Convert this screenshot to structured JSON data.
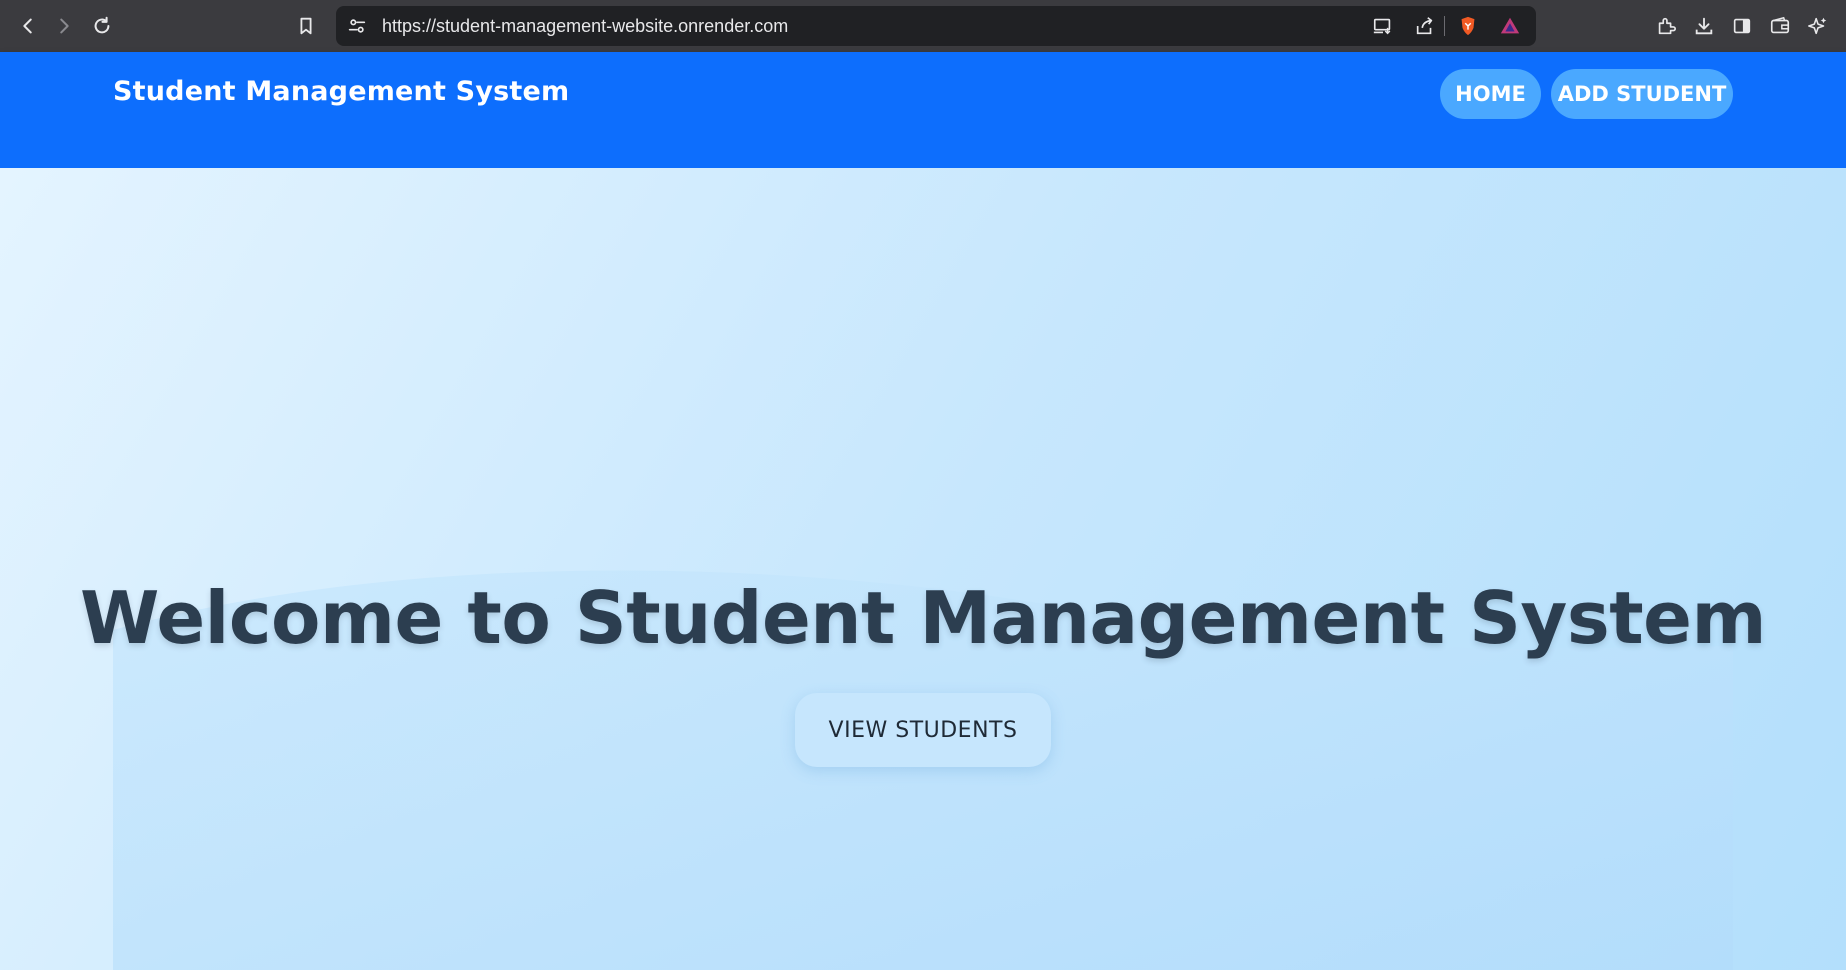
{
  "browser": {
    "url": "https://student-management-website.onrender.com"
  },
  "header": {
    "brand": "Student Management System",
    "nav": [
      {
        "label": "HOME"
      },
      {
        "label": "ADD STUDENT"
      }
    ],
    "color": "#0d6efd",
    "button_color": "#4aa8ff"
  },
  "hero": {
    "title": "Welcome to Student Management System",
    "cta_label": "VIEW STUDENTS",
    "title_color": "#2c3e50"
  }
}
